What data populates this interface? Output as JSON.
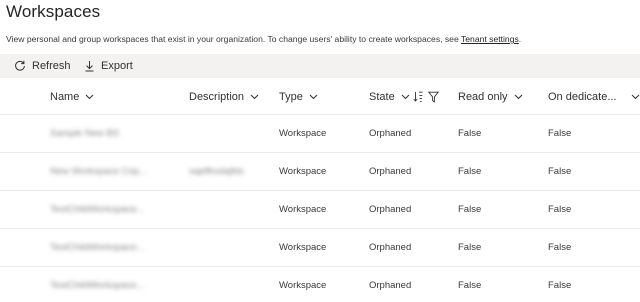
{
  "page": {
    "title": "Workspaces",
    "subtitle_prefix": "View personal and group workspaces that exist in your organization. To change users' ability to create workspaces, see ",
    "subtitle_link": "Tenant settings",
    "subtitle_suffix": "."
  },
  "toolbar": {
    "refresh_label": "Refresh",
    "export_label": "Export",
    "refresh_icon": "refresh-icon",
    "export_icon": "download-icon"
  },
  "table": {
    "columns": [
      {
        "label": "Name",
        "icon": "chevron-down-icon"
      },
      {
        "label": "Description",
        "icon": "chevron-down-icon"
      },
      {
        "label": "Type",
        "icon": "chevron-down-icon"
      },
      {
        "label": "State",
        "icon": "chevron-down-icon",
        "sort_icon": "sort-ascending-icon",
        "filter_icon": "filter-icon"
      },
      {
        "label": "Read only",
        "icon": "chevron-down-icon"
      },
      {
        "label": "On dedicate...",
        "icon": "chevron-down-icon"
      }
    ],
    "rows": [
      {
        "name": "Sample New BS",
        "description": "",
        "type": "Workspace",
        "state": "Orphaned",
        "read_only": "False",
        "on_dedicated": "False"
      },
      {
        "name": "New Workspace Cop...",
        "description": "sajdfksdajfds",
        "type": "Workspace",
        "state": "Orphaned",
        "read_only": "False",
        "on_dedicated": "False"
      },
      {
        "name": "TestChildWorkspace...",
        "description": "",
        "type": "Workspace",
        "state": "Orphaned",
        "read_only": "False",
        "on_dedicated": "False"
      },
      {
        "name": "TestChildWorkspace...",
        "description": "",
        "type": "Workspace",
        "state": "Orphaned",
        "read_only": "False",
        "on_dedicated": "False"
      },
      {
        "name": "TestChildWorkspace...",
        "description": "",
        "type": "Workspace",
        "state": "Orphaned",
        "read_only": "False",
        "on_dedicated": "False"
      }
    ]
  },
  "colors": {
    "toolbar_bg": "#f3f2f1",
    "divider": "#edebe9",
    "text": "#252423"
  }
}
